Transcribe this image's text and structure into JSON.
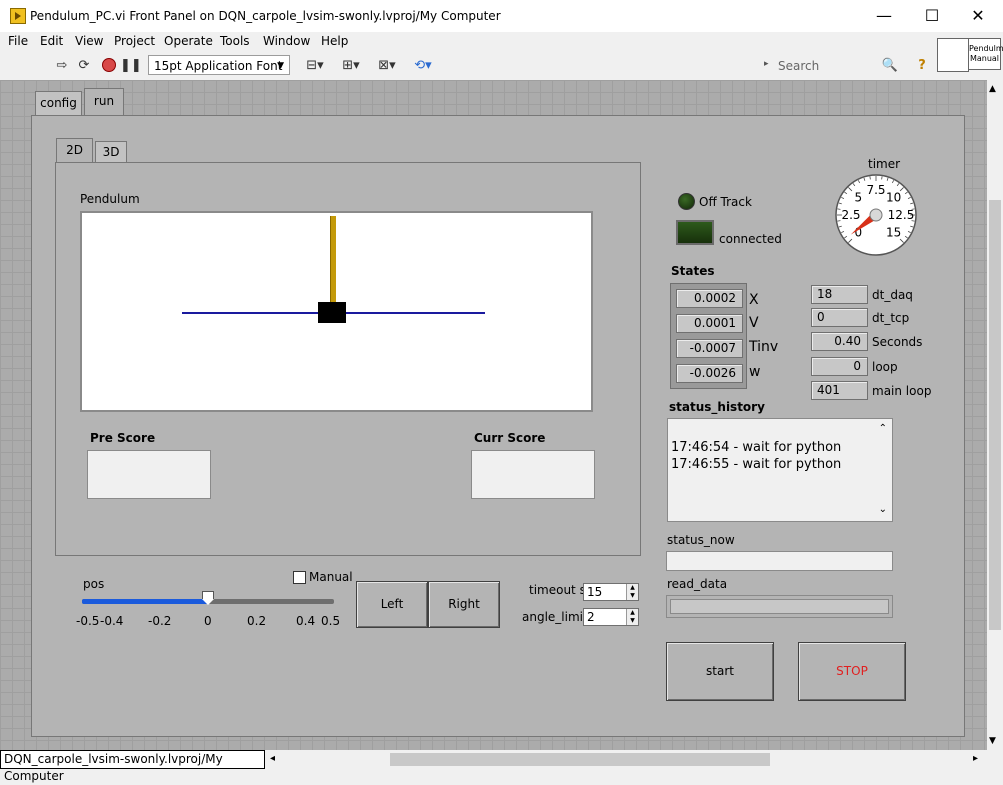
{
  "window": {
    "title": "Pendulum_PC.vi Front Panel on DQN_carpole_lvsim-swonly.lvproj/My Computer",
    "minimize": "—",
    "maximize": "☐",
    "close": "✕"
  },
  "menu": [
    "File",
    "Edit",
    "View",
    "Project",
    "Operate",
    "Tools",
    "Window",
    "Help"
  ],
  "toolbar": {
    "font": "15pt Application Font",
    "search_placeholder": "Search",
    "icons": [
      "run-arrow-icon",
      "run-continuous-icon",
      "abort-icon",
      "pause-icon",
      "align-icon",
      "distribute-icon",
      "resize-icon",
      "reorder-icon",
      "search-icon",
      "help-icon"
    ]
  },
  "vi_icon": {
    "line1": "Pendulm",
    "line2": "Manual"
  },
  "tabs": {
    "main": [
      {
        "label": "config"
      },
      {
        "label": "run"
      }
    ],
    "sub": [
      {
        "label": "2D"
      },
      {
        "label": "3D"
      }
    ]
  },
  "plot": {
    "label": "Pendulum"
  },
  "scores": {
    "pre_label": "Pre Score",
    "curr_label": "Curr Score",
    "pre_value": "",
    "curr_value": ""
  },
  "slider": {
    "label": "pos",
    "ticks": [
      "-0.5",
      "-0.4",
      "-0.2",
      "0",
      "0.2",
      "0.4",
      "0.5"
    ],
    "value": 0,
    "min": -0.5,
    "max": 0.5
  },
  "manual": {
    "label": "Manual",
    "checked": false
  },
  "buttons": {
    "left": "Left",
    "right": "Right",
    "start": "start",
    "stop": "STOP"
  },
  "controls": {
    "timeout_label": "timeout s",
    "timeout_value": "15",
    "angle_label": "angle_limit",
    "angle_value": "2"
  },
  "indicators": {
    "off_track": "Off Track",
    "connected": "connected"
  },
  "states": {
    "title": "States",
    "rows": [
      {
        "value": "0.0002",
        "label": "X"
      },
      {
        "value": "0.0001",
        "label": "V"
      },
      {
        "value": "-0.0007",
        "label": "Tinv"
      },
      {
        "value": "-0.0026",
        "label": "w"
      }
    ]
  },
  "metrics": [
    {
      "value": "18",
      "label": "dt_daq",
      "align": "left"
    },
    {
      "value": "0",
      "label": "dt_tcp",
      "align": "left"
    },
    {
      "value": "0.40",
      "label": "Seconds",
      "align": "right"
    },
    {
      "value": "0",
      "label": "loop",
      "align": "right"
    },
    {
      "value": "401",
      "label": "main loop",
      "align": "left"
    }
  ],
  "timer": {
    "label": "timer",
    "ticks": [
      "0",
      "2.5",
      "5",
      "7.5",
      "10",
      "12.5",
      "15"
    ],
    "value": 0.4
  },
  "status": {
    "history_label": "status_history",
    "history": [
      "17:46:54 - wait for python",
      "17:46:55 - wait for python"
    ],
    "now_label": "status_now",
    "now_value": "",
    "read_label": "read_data",
    "read_value": ""
  },
  "statusbar": "DQN_carpole_lvsim-swonly.lvproj/My Computer",
  "colors": {
    "panel": "#ababab",
    "pendulum_rod": "#c49a0a",
    "track": "#1a1a9e",
    "cart": "#000000",
    "led_off": "#1f3f10",
    "slider_fill": "#1a5adc",
    "stop_text": "#e02020"
  }
}
